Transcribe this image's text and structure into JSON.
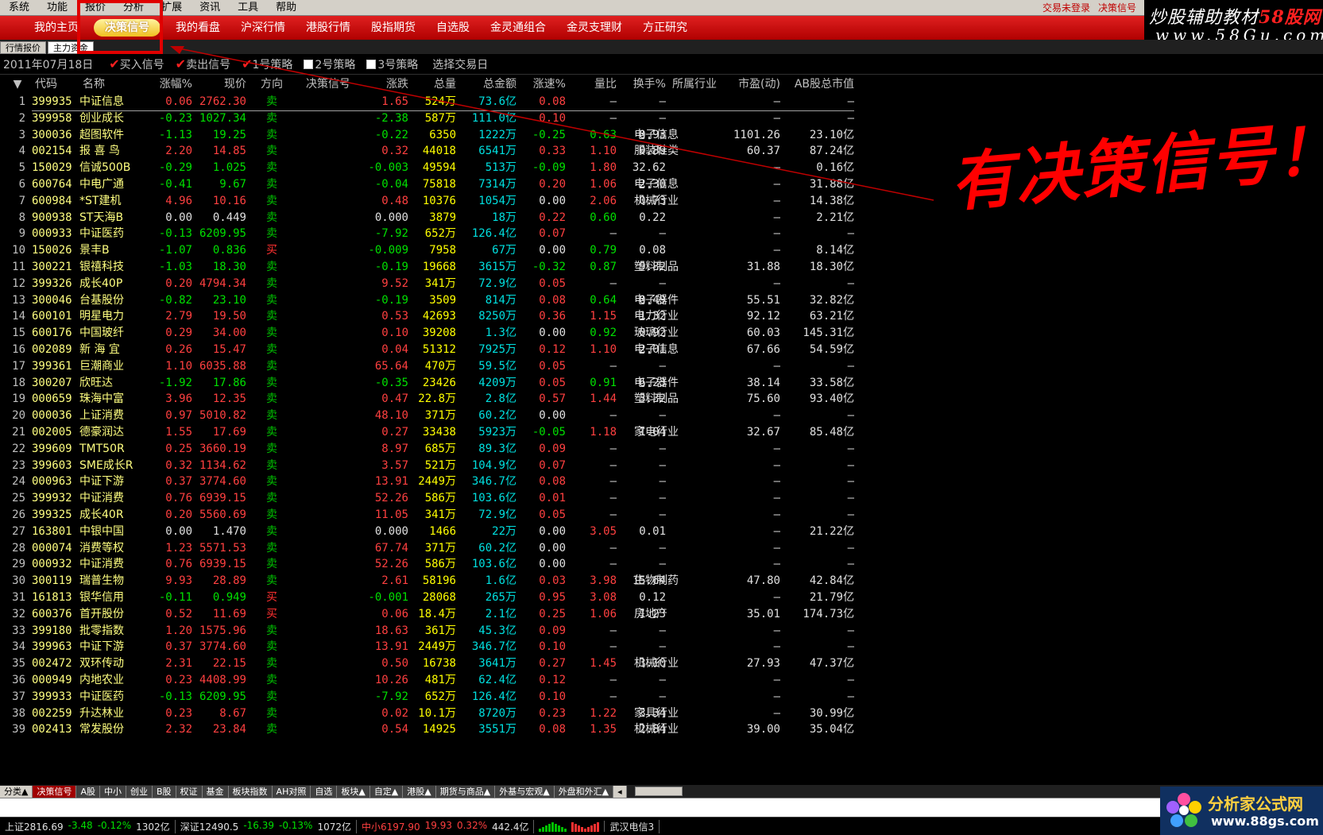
{
  "menu": {
    "items": [
      "系统",
      "功能",
      "报价",
      "分析",
      "扩展",
      "资讯",
      "工具",
      "帮助"
    ],
    "status_login": "交易未登录",
    "status_signal": "决策信号"
  },
  "nav": {
    "items": [
      "我的主页",
      "决策信号",
      "我的看盘",
      "沪深行情",
      "港股行情",
      "股指期货",
      "自选股",
      "金灵通组合",
      "金灵支理财",
      "方正研究"
    ],
    "active_index": 1
  },
  "subtabs": [
    "行情报价",
    "主力资金"
  ],
  "toolbar": {
    "date": "2011年07月18日",
    "buy_signal": "买入信号",
    "sell_signal": "卖出信号",
    "strategy1": "1号策略",
    "strategy2": "2号策略",
    "strategy3": "3号策略",
    "select_day": "选择交易日"
  },
  "watermark_top": {
    "l1_a": "炒股辅助教材",
    "l1_b": "58股网",
    "l2": "www.58Gu.com"
  },
  "annotation": "有决策信号！",
  "table": {
    "headers": [
      "代码",
      "名称",
      "涨幅%",
      "现价",
      "方向",
      "决策信号",
      "涨跌",
      "总量",
      "总金额",
      "涨速%",
      "量比",
      "换手%",
      "所属行业",
      "市盈(动)",
      "AB股总市值"
    ],
    "rows": [
      [
        "1",
        "399935",
        "中证信息",
        "0.06",
        "2762.30",
        "卖",
        "1.65",
        "524万",
        "73.6亿",
        "0.08",
        "—",
        "—",
        "",
        "—",
        "—"
      ],
      [
        "2",
        "399958",
        "创业成长",
        "-0.23",
        "1027.34",
        "卖",
        "-2.38",
        "587万",
        "111.0亿",
        "0.10",
        "—",
        "—",
        "",
        "—",
        "—"
      ],
      [
        "3",
        "300036",
        "超图软件",
        "-1.13",
        "19.25",
        "卖",
        "-0.22",
        "6350",
        "1222万",
        "-0.25",
        "0.63",
        "0.93",
        "电子信息",
        "1101.26",
        "23.10亿"
      ],
      [
        "4",
        "002154",
        "报 喜 鸟",
        "2.20",
        "14.85",
        "卖",
        "0.32",
        "44018",
        "6541万",
        "0.33",
        "1.10",
        "0.89",
        "服装鞋类",
        "60.37",
        "87.24亿"
      ],
      [
        "5",
        "150029",
        "信诚500B",
        "-0.29",
        "1.025",
        "卖",
        "-0.003",
        "49594",
        "513万",
        "-0.09",
        "1.80",
        "32.62",
        "",
        "—",
        "0.16亿"
      ],
      [
        "6",
        "600764",
        "中电广通",
        "-0.41",
        "9.67",
        "卖",
        "-0.04",
        "75818",
        "7314万",
        "0.20",
        "1.06",
        "2.30",
        "电子信息",
        "—",
        "31.88亿"
      ],
      [
        "7",
        "600984",
        "*ST建机",
        "4.96",
        "10.16",
        "卖",
        "0.48",
        "10376",
        "1054万",
        "0.00",
        "2.06",
        "0.73",
        "机械行业",
        "—",
        "14.38亿"
      ],
      [
        "8",
        "900938",
        "ST天海B",
        "0.00",
        "0.449",
        "卖",
        "0.000",
        "3879",
        "18万",
        "0.22",
        "0.60",
        "0.22",
        "",
        "—",
        "2.21亿"
      ],
      [
        "9",
        "000933",
        "中证医药",
        "-0.13",
        "6209.95",
        "卖",
        "-7.92",
        "652万",
        "126.4亿",
        "0.07",
        "—",
        "—",
        "",
        "—",
        "—"
      ],
      [
        "10",
        "150026",
        "景丰B",
        "-1.07",
        "0.836",
        "买",
        "-0.009",
        "7958",
        "67万",
        "0.00",
        "0.79",
        "0.08",
        "",
        "—",
        "8.14亿"
      ],
      [
        "11",
        "300221",
        "银禧科技",
        "-1.03",
        "18.30",
        "卖",
        "-0.19",
        "19668",
        "3615万",
        "-0.32",
        "0.87",
        "9.82",
        "塑料制品",
        "31.88",
        "18.30亿"
      ],
      [
        "12",
        "399326",
        "成长40P",
        "0.20",
        "4794.34",
        "卖",
        "9.52",
        "341万",
        "72.9亿",
        "0.05",
        "—",
        "—",
        "",
        "—",
        "—"
      ],
      [
        "13",
        "300046",
        "台基股份",
        "-0.82",
        "23.10",
        "卖",
        "-0.19",
        "3509",
        "814万",
        "0.08",
        "0.64",
        "0.49",
        "电子器件",
        "55.51",
        "32.82亿"
      ],
      [
        "14",
        "600101",
        "明星电力",
        "2.79",
        "19.50",
        "卖",
        "0.53",
        "42693",
        "8250万",
        "0.36",
        "1.15",
        "1.32",
        "电力行业",
        "92.12",
        "63.21亿"
      ],
      [
        "15",
        "600176",
        "中国玻纤",
        "0.29",
        "34.00",
        "卖",
        "0.10",
        "39208",
        "1.3亿",
        "0.00",
        "0.92",
        "0.92",
        "玻璃行业",
        "60.03",
        "145.31亿"
      ],
      [
        "16",
        "002089",
        "新 海 宜",
        "0.26",
        "15.47",
        "卖",
        "0.04",
        "51312",
        "7925万",
        "0.12",
        "1.10",
        "2.01",
        "电子信息",
        "67.66",
        "54.59亿"
      ],
      [
        "17",
        "399361",
        "巨潮商业",
        "1.10",
        "6035.88",
        "卖",
        "65.64",
        "470万",
        "59.5亿",
        "0.05",
        "—",
        "—",
        "",
        "—",
        "—"
      ],
      [
        "18",
        "300207",
        "欣旺达",
        "-1.92",
        "17.86",
        "卖",
        "-0.35",
        "23426",
        "4209万",
        "0.05",
        "0.91",
        "6.23",
        "电子器件",
        "38.14",
        "33.58亿"
      ],
      [
        "19",
        "000659",
        "珠海中富",
        "3.96",
        "12.35",
        "卖",
        "0.47",
        "22.8万",
        "2.8亿",
        "0.57",
        "1.44",
        "3.32",
        "塑料制品",
        "75.60",
        "93.40亿"
      ],
      [
        "20",
        "000036",
        "上证消费",
        "0.97",
        "5010.82",
        "卖",
        "48.10",
        "371万",
        "60.2亿",
        "0.00",
        "—",
        "—",
        "",
        "—",
        "—"
      ],
      [
        "21",
        "002005",
        "德豪润达",
        "1.55",
        "17.69",
        "卖",
        "0.27",
        "33438",
        "5923万",
        "-0.05",
        "1.18",
        "1.04",
        "家电行业",
        "32.67",
        "85.48亿"
      ],
      [
        "22",
        "399609",
        "TMT50R",
        "0.25",
        "3660.19",
        "卖",
        "8.97",
        "685万",
        "89.3亿",
        "0.09",
        "—",
        "—",
        "",
        "—",
        "—"
      ],
      [
        "23",
        "399603",
        "SME成长R",
        "0.32",
        "1134.62",
        "卖",
        "3.57",
        "521万",
        "104.9亿",
        "0.07",
        "—",
        "—",
        "",
        "—",
        "—"
      ],
      [
        "24",
        "000963",
        "中证下游",
        "0.37",
        "3774.60",
        "卖",
        "13.91",
        "2449万",
        "346.7亿",
        "0.08",
        "—",
        "—",
        "",
        "—",
        "—"
      ],
      [
        "25",
        "399932",
        "中证消费",
        "0.76",
        "6939.15",
        "卖",
        "52.26",
        "586万",
        "103.6亿",
        "0.01",
        "—",
        "—",
        "",
        "—",
        "—"
      ],
      [
        "26",
        "399325",
        "成长40R",
        "0.20",
        "5560.69",
        "卖",
        "11.05",
        "341万",
        "72.9亿",
        "0.05",
        "—",
        "—",
        "",
        "—",
        "—"
      ],
      [
        "27",
        "163801",
        "中银中国",
        "0.00",
        "1.470",
        "卖",
        "0.000",
        "1466",
        "22万",
        "0.00",
        "3.05",
        "0.01",
        "",
        "—",
        "21.22亿"
      ],
      [
        "28",
        "000074",
        "消费等权",
        "1.23",
        "5571.53",
        "卖",
        "67.74",
        "371万",
        "60.2亿",
        "0.00",
        "—",
        "—",
        "",
        "—",
        "—"
      ],
      [
        "29",
        "000932",
        "中证消费",
        "0.76",
        "6939.15",
        "卖",
        "52.26",
        "586万",
        "103.6亿",
        "0.00",
        "—",
        "—",
        "",
        "—",
        "—"
      ],
      [
        "30",
        "300119",
        "瑞普生物",
        "9.93",
        "28.89",
        "卖",
        "2.61",
        "58196",
        "1.6亿",
        "0.03",
        "3.98",
        "15.64",
        "生物制药",
        "47.80",
        "42.84亿"
      ],
      [
        "31",
        "161813",
        "银华信用",
        "-0.11",
        "0.949",
        "买",
        "-0.001",
        "28068",
        "265万",
        "0.95",
        "3.08",
        "0.12",
        "",
        "—",
        "21.79亿"
      ],
      [
        "32",
        "600376",
        "首开股份",
        "0.52",
        "11.69",
        "买",
        "0.06",
        "18.4万",
        "2.1亿",
        "0.25",
        "1.06",
        "1.23",
        "房地产",
        "35.01",
        "174.73亿"
      ],
      [
        "33",
        "399180",
        "批零指数",
        "1.20",
        "1575.96",
        "卖",
        "18.63",
        "361万",
        "45.3亿",
        "0.09",
        "—",
        "—",
        "",
        "—",
        "—"
      ],
      [
        "34",
        "399963",
        "中证下游",
        "0.37",
        "3774.60",
        "卖",
        "13.91",
        "2449万",
        "346.7亿",
        "0.10",
        "—",
        "—",
        "",
        "—",
        "—"
      ],
      [
        "35",
        "002472",
        "双环传动",
        "2.31",
        "22.15",
        "卖",
        "0.50",
        "16738",
        "3641万",
        "0.27",
        "1.45",
        "3.10",
        "机械行业",
        "27.93",
        "47.37亿"
      ],
      [
        "36",
        "000949",
        "内地农业",
        "0.23",
        "4408.99",
        "卖",
        "10.26",
        "481万",
        "62.4亿",
        "0.12",
        "—",
        "—",
        "",
        "—",
        "—"
      ],
      [
        "37",
        "399933",
        "中证医药",
        "-0.13",
        "6209.95",
        "卖",
        "-7.92",
        "652万",
        "126.4亿",
        "0.10",
        "—",
        "—",
        "",
        "—",
        "—"
      ],
      [
        "38",
        "002259",
        "升达林业",
        "0.23",
        "8.67",
        "卖",
        "0.02",
        "10.1万",
        "8720万",
        "0.23",
        "1.22",
        "3.34",
        "家具行业",
        "—",
        "30.99亿"
      ],
      [
        "39",
        "002413",
        "常发股份",
        "2.32",
        "23.84",
        "卖",
        "0.54",
        "14925",
        "3551万",
        "0.08",
        "1.35",
        "2.84",
        "机械行业",
        "39.00",
        "35.04亿"
      ]
    ]
  },
  "bottom_tabs": [
    "分类▲",
    "决策信号",
    "A股",
    "中小",
    "创业",
    "B股",
    "权证",
    "基金",
    "板块指数",
    "AH对照",
    "自选",
    "板块▲",
    "自定▲",
    "港股▲",
    "期货与商品▲",
    "外基与宏观▲",
    "外盘和外汇▲"
  ],
  "statusbar": {
    "sh": "上证2816.69",
    "sh_chg": "-3.48",
    "sh_pct": "-0.12%",
    "sh_amt": "1302亿",
    "sz": "深证12490.5",
    "sz_chg": "-16.39",
    "sz_pct": "-0.13%",
    "sz_amt": "1072亿",
    "zx": "中小6197.90",
    "zx_chg": "19.93",
    "zx_pct": "0.32%",
    "zx_amt": "442.4亿",
    "isp": "武汉电信3"
  },
  "watermark_bottom": {
    "t1": "分析家公式网",
    "t2": "www.88gs.com"
  },
  "colors": {
    "up": "#ff4040",
    "down": "#00e000",
    "code": "#ffff80",
    "nav_red": "#c00000",
    "annotation": "#ff0000"
  }
}
